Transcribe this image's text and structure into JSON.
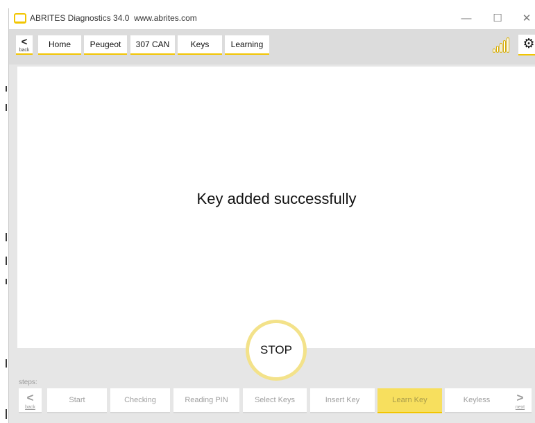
{
  "window": {
    "title": "ABRITES Diagnostics 34.0",
    "url": "www.abrites.com",
    "minimize_glyph": "—",
    "maximize_glyph": "☐",
    "close_glyph": "✕"
  },
  "navbar": {
    "back_glyph": "<",
    "back_label": "back",
    "breadcrumbs": [
      "Home",
      "Peugeot",
      "307 CAN",
      "Keys",
      "Learning"
    ],
    "signal_icon": "signal-strength-icon",
    "signal_color": "#d9ae00",
    "settings_icon": "gear-icon",
    "settings_glyph": "⚙"
  },
  "main": {
    "message": "Key added successfully"
  },
  "stop": {
    "label": "STOP",
    "ring_color": "#f3e28a"
  },
  "steps": {
    "label": "steps:",
    "back_glyph": "<",
    "back_label": "back",
    "next_glyph": ">",
    "next_label": "next",
    "items": [
      "Start",
      "Checking",
      "Reading PIN",
      "Select Keys",
      "Insert Key",
      "Learn Key",
      "Keyless"
    ],
    "active": "Learn Key",
    "accent_color": "#f2c500"
  }
}
